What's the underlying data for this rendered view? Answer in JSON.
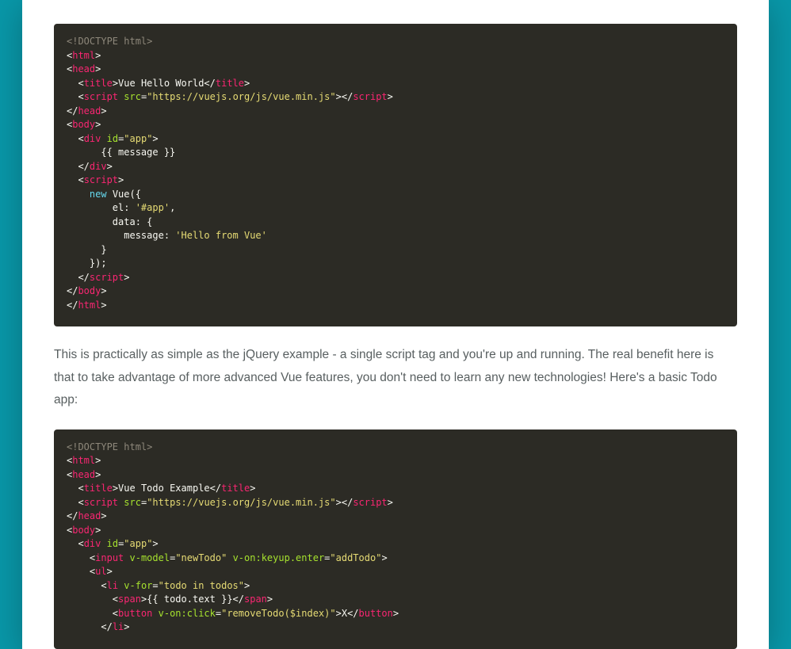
{
  "paragraph": "This is practically as simple as the jQuery example - a single script tag and you're up and running. The real benefit here is that to take advantage of more advanced Vue features, you don't need to learn any new technologies! Here's a basic Todo app:",
  "code1": {
    "doctype": "<!DOCTYPE html>",
    "title_text": "Vue Hello World",
    "vue_url": "\"https://vuejs.org/js/vue.min.js\"",
    "app_id": "\"app\"",
    "message_tmpl": "      {{ message }}",
    "el_val": "'#app'",
    "msg_val": "'Hello from Vue'",
    "tags": {
      "html": "html",
      "head": "head",
      "title": "title",
      "script": "script",
      "body": "body",
      "div": "div"
    },
    "attrs": {
      "src": "src",
      "id": "id"
    },
    "kw": {
      "new": "new",
      "Vue": "Vue",
      "el": "el",
      "data": "data",
      "message": "message"
    },
    "sym": {
      "open_paren": "({",
      "close_brace": "}",
      "close_brace_paren": "});",
      "colon": ": ",
      "comma": ",",
      "open_brace": "{",
      "lt": "<",
      "gt": ">",
      "lt_close": "</",
      "close_empty": ">",
      "eq": "=",
      "slash_gt": "></",
      "slash": "/"
    }
  },
  "code2": {
    "doctype": "<!DOCTYPE html>",
    "title_text": "Vue Todo Example",
    "vue_url": "\"https://vuejs.org/js/vue.min.js\"",
    "app_id": "\"app\"",
    "newTodo": "\"newTodo\"",
    "addTodo": "\"addTodo\"",
    "vfor": "\"todo in todos\"",
    "todotext": "{{ todo.text }}",
    "removeTodo": "\"removeTodo($index)\"",
    "X": "X",
    "tags": {
      "html": "html",
      "head": "head",
      "title": "title",
      "script": "script",
      "body": "body",
      "div": "div",
      "input": "input",
      "ul": "ul",
      "li": "li",
      "span": "span",
      "button": "button"
    },
    "attrs": {
      "src": "src",
      "id": "id",
      "vmodel": "v-model",
      "vfor": "v-for",
      "keyup": "v-on:keyup.enter",
      "click": "v-on:click"
    }
  }
}
